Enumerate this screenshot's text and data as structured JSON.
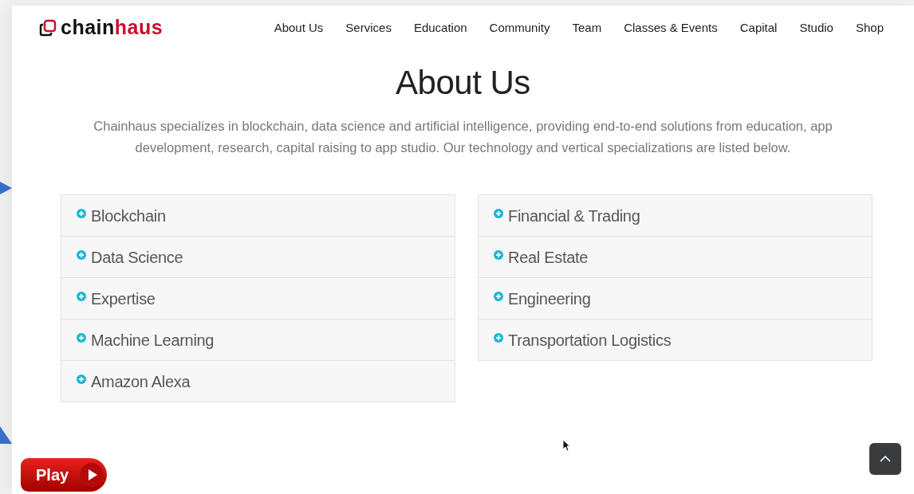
{
  "logo": {
    "dark": "chain",
    "accent": "haus"
  },
  "nav": [
    {
      "label": "About Us"
    },
    {
      "label": "Services"
    },
    {
      "label": "Education"
    },
    {
      "label": "Community"
    },
    {
      "label": "Team"
    },
    {
      "label": "Classes & Events"
    },
    {
      "label": "Capital"
    },
    {
      "label": "Studio"
    },
    {
      "label": "Shop"
    }
  ],
  "heading": "About Us",
  "intro": "Chainhaus specializes in blockchain, data science and artificial intelligence, providing end-to-end solutions from education, app development, research, capital raising to app studio. Our technology and vertical specializations are listed below.",
  "accordions": [
    [
      {
        "label": "Blockchain",
        "expanded": false
      },
      {
        "label": "Data Science",
        "expanded": false
      },
      {
        "label": "Expertise",
        "expanded": false
      },
      {
        "label": "Machine Learning",
        "expanded": false
      },
      {
        "label": "Amazon Alexa",
        "expanded": false
      }
    ],
    [
      {
        "label": "Financial & Trading",
        "expanded": false
      },
      {
        "label": "Real Estate",
        "expanded": false
      },
      {
        "label": "Engineering",
        "expanded": false
      },
      {
        "label": "Transportation Logistics",
        "expanded": false
      }
    ]
  ],
  "play_button": {
    "label": "Play"
  }
}
